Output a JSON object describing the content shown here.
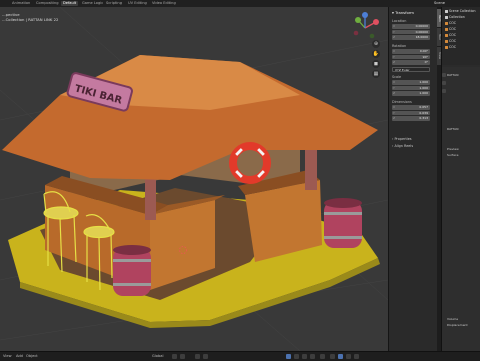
{
  "workspace_tabs": [
    {
      "label": "Animation",
      "active": false
    },
    {
      "label": "Compositing",
      "active": false
    },
    {
      "label": "Default",
      "active": true
    },
    {
      "label": "Game Logic",
      "active": false
    },
    {
      "label": "Scripting",
      "active": false
    },
    {
      "label": "UV Editing",
      "active": false
    },
    {
      "label": "Video Editing",
      "active": false
    }
  ],
  "scene_name": "Scene",
  "viewport": {
    "projection": "...pective",
    "collection": "...Collection | RATTAN LINK 22",
    "sign_text": "TIKI BAR"
  },
  "npanel": {
    "header": "Transform",
    "location_label": "Location",
    "location": [
      {
        "axis": "X",
        "value": "0.00000"
      },
      {
        "axis": "Y",
        "value": "0.00000"
      },
      {
        "axis": "Z",
        "value": "18.0000"
      }
    ],
    "rotation_label": "Rotation",
    "rotation": [
      {
        "axis": "X",
        "value": "0.00°"
      },
      {
        "axis": "Y",
        "value": "90°"
      },
      {
        "axis": "Z",
        "value": "0°"
      }
    ],
    "mode": "XYZ Euler",
    "scale_label": "Scale",
    "scale": [
      {
        "axis": "X",
        "value": "1.000"
      },
      {
        "axis": "Y",
        "value": "1.000"
      },
      {
        "axis": "Z",
        "value": "1.000"
      }
    ],
    "dimensions_label": "Dimensions",
    "dimensions": [
      {
        "axis": "X",
        "value": "0.057"
      },
      {
        "axis": "Y",
        "value": "0.039"
      },
      {
        "axis": "Z",
        "value": "0.313"
      }
    ],
    "properties_label": "Properties",
    "align_label": "Align Reels",
    "tabs": [
      "Item",
      "Tool",
      "View"
    ]
  },
  "outliner": {
    "items": [
      "Scene Collection",
      "Collection",
      "COC",
      "COC",
      "COC",
      "COC",
      "COC"
    ]
  },
  "properties": {
    "items": [
      "RATTAN",
      "RATTAN",
      "Preview",
      "Surface",
      "Volume",
      "Displacement"
    ]
  },
  "statusbar": {
    "view_label": "View",
    "add_label": "Add",
    "object_label": "Object",
    "global_label": "Global"
  }
}
